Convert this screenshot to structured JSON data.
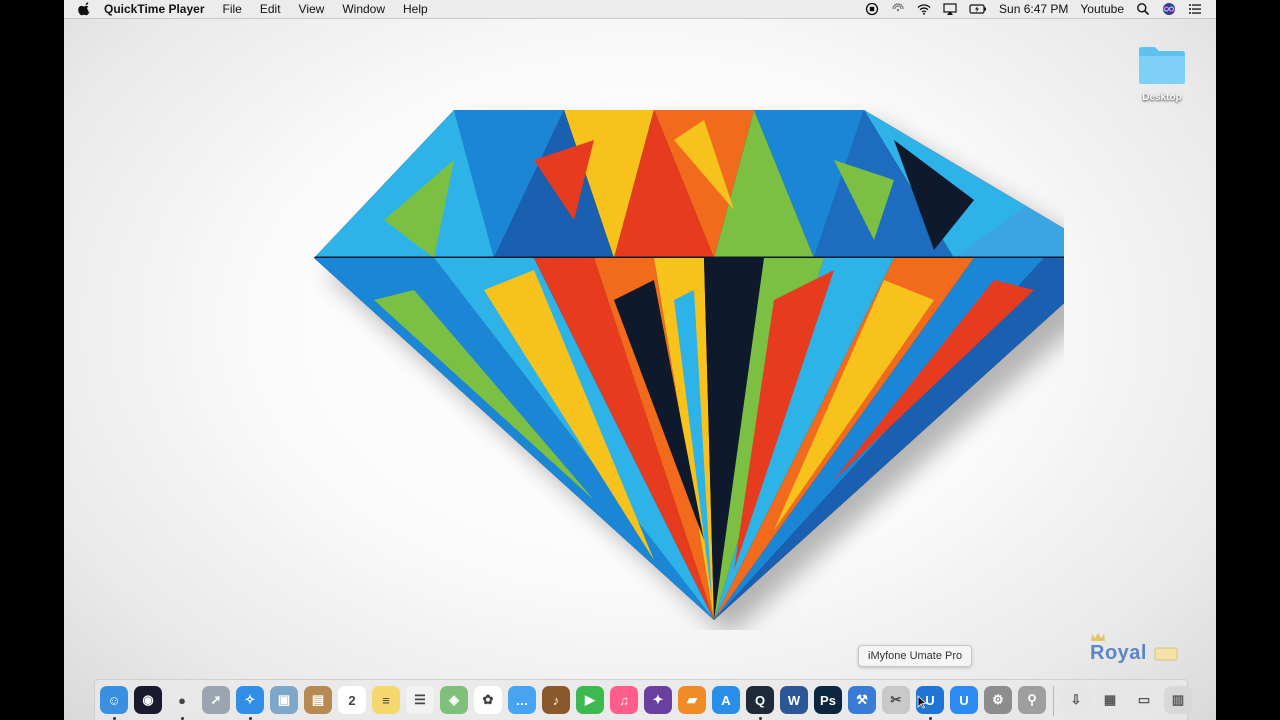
{
  "menubar": {
    "app_name": "QuickTime Player",
    "menus": [
      "File",
      "Edit",
      "View",
      "Window",
      "Help"
    ],
    "clock": "Sun 6:47 PM",
    "user": "Youtube"
  },
  "desktop": {
    "folder_label": "Desktop"
  },
  "tooltip": {
    "text": "iMyfone Umate Pro"
  },
  "watermark": {
    "text": "Royal"
  },
  "dock": {
    "apps": [
      {
        "icon": "finder-icon",
        "glyph": "☺",
        "color": "#3b8fe0"
      },
      {
        "icon": "siri-icon",
        "glyph": "◉",
        "color": "#1a1a2e"
      },
      {
        "icon": "chrome-icon",
        "glyph": "●",
        "color": "#e8e8e8"
      },
      {
        "icon": "launchpad-icon",
        "glyph": "➚",
        "color": "#9aa5b1"
      },
      {
        "icon": "safari-icon",
        "glyph": "✧",
        "color": "#2f8fe6"
      },
      {
        "icon": "preview-icon",
        "glyph": "▣",
        "color": "#7fa7c9"
      },
      {
        "icon": "contacts-icon",
        "glyph": "▤",
        "color": "#b68a52"
      },
      {
        "icon": "calendar-icon",
        "glyph": "2",
        "color": "#ffffff"
      },
      {
        "icon": "notes-icon",
        "glyph": "≡",
        "color": "#f4d86b"
      },
      {
        "icon": "reminders-icon",
        "glyph": "☰",
        "color": "#f2f2f2"
      },
      {
        "icon": "maps-icon",
        "glyph": "◈",
        "color": "#7ec07a"
      },
      {
        "icon": "photos-icon",
        "glyph": "✿",
        "color": "#ffffff"
      },
      {
        "icon": "messages-icon",
        "glyph": "…",
        "color": "#47a4f3"
      },
      {
        "icon": "garageband-icon",
        "glyph": "♪",
        "color": "#8a5a2c"
      },
      {
        "icon": "facetime-icon",
        "glyph": "▶",
        "color": "#3dba4f"
      },
      {
        "icon": "itunes-icon",
        "glyph": "♫",
        "color": "#ff5e8a"
      },
      {
        "icon": "imovie-icon",
        "glyph": "✦",
        "color": "#6a3fa0"
      },
      {
        "icon": "ibooks-icon",
        "glyph": "▰",
        "color": "#f08b25"
      },
      {
        "icon": "app-store-icon",
        "glyph": "A",
        "color": "#2a8fe8"
      },
      {
        "icon": "quicktime-icon",
        "glyph": "Q",
        "color": "#1e2a3a"
      },
      {
        "icon": "word-icon",
        "glyph": "W",
        "color": "#2b5797"
      },
      {
        "icon": "photoshop-icon",
        "glyph": "Ps",
        "color": "#0b2740"
      },
      {
        "icon": "xcode-icon",
        "glyph": "⚒",
        "color": "#3a7bd5"
      },
      {
        "icon": "utilities-icon",
        "glyph": "✂",
        "color": "#c9c9c9"
      },
      {
        "icon": "umate-pro-icon",
        "glyph": "U",
        "color": "#1f74d6"
      },
      {
        "icon": "umate-icon",
        "glyph": "U",
        "color": "#2b8bf2"
      },
      {
        "icon": "system-preferences-icon",
        "glyph": "⚙",
        "color": "#8d8d8d"
      },
      {
        "icon": "drill-icon",
        "glyph": "⚲",
        "color": "#9e9e9e"
      }
    ],
    "stacks": [
      {
        "icon": "downloads-stack-icon",
        "glyph": "⇩",
        "color": "#e6e6e6"
      },
      {
        "icon": "documents-stack-icon",
        "glyph": "▦",
        "color": "#e6e6e6"
      },
      {
        "icon": "desktop-stack-icon",
        "glyph": "▭",
        "color": "#e6e6e6"
      },
      {
        "icon": "trash-icon",
        "glyph": "▥",
        "color": "#d8d8d8"
      }
    ]
  },
  "colors": {
    "menubar_bg": "#ececec",
    "folder_blue": "#5ec1f0",
    "diamond_palette": [
      "#1b86d6",
      "#2db3e8",
      "#f26a1b",
      "#e63b1f",
      "#f7c21b",
      "#7bc043",
      "#0e1a2b"
    ]
  }
}
